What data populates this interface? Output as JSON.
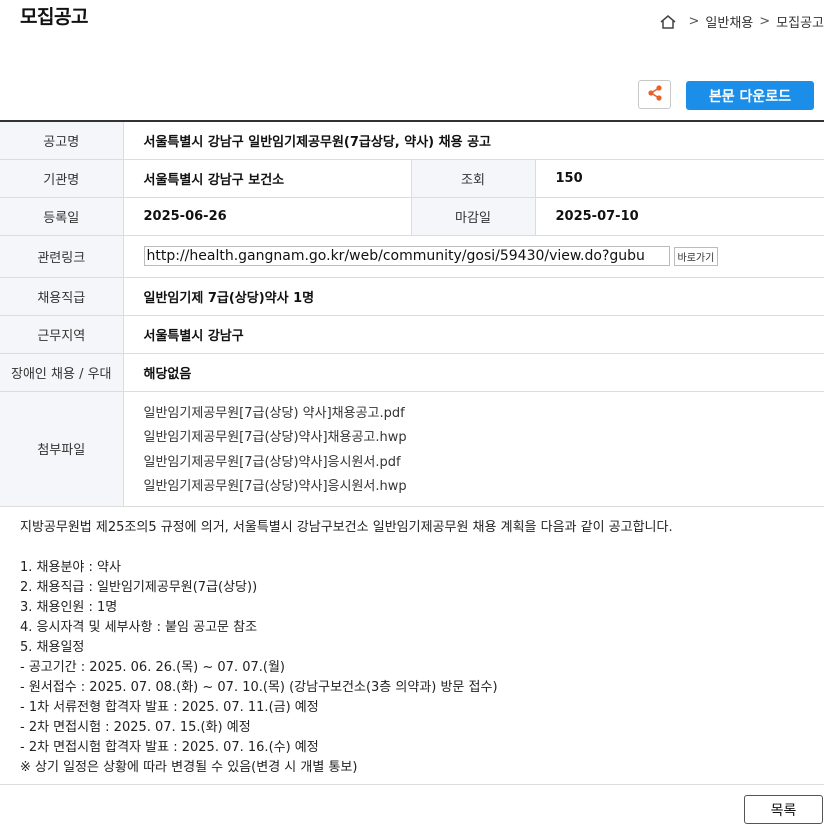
{
  "page": {
    "title": "모집공고"
  },
  "breadcrumb": {
    "items": [
      "일반채용",
      "모집공고"
    ]
  },
  "actions": {
    "download_label": "본문 다운로드"
  },
  "info": {
    "title_label": "공고명",
    "title_value": "서울특별시 강남구 일반임기제공무원(7급상당, 약사) 채용 공고",
    "agency_label": "기관명",
    "agency_value": "서울특별시 강남구 보건소",
    "views_label": "조회",
    "views_value": "150",
    "posted_label": "등록일",
    "posted_value": "2025-06-26",
    "deadline_label": "마감일",
    "deadline_value": "2025-07-10",
    "link_label": "관련링크",
    "link_value": "http://health.gangnam.go.kr/web/community/gosi/59430/view.do?gubu",
    "link_go_label": "바로가기",
    "position_label": "채용직급",
    "position_value": "일반임기제 7급(상당)약사 1명",
    "region_label": "근무지역",
    "region_value": "서울특별시 강남구",
    "disability_label": "장애인 채용 / 우대",
    "disability_value": "해당없음",
    "attachments_label": "첨부파일",
    "attachments": [
      "일반임기제공무원[7급(상당) 약사]채용공고.pdf",
      "일반임기제공무원[7급(상당)약사]채용공고.hwp",
      "일반임기제공무원[7급(상당)약사]응시원서.pdf",
      "일반임기제공무원[7급(상당)약사]응시원서.hwp"
    ]
  },
  "body": {
    "intro": "지방공무원법 제25조의5 규정에 의거, 서울특별시 강남구보건소 일반임기제공무원 채용 계획을 다음과 같이 공고합니다.",
    "lines": [
      "1. 채용분야 : 약사",
      "2. 채용직급 : 일반임기제공무원(7급(상당))",
      "3. 채용인원 : 1명",
      "4. 응시자격 및 세부사항 : 붙임 공고문 참조",
      "5. 채용일정",
      "- 공고기간 : 2025. 06. 26.(목) ~ 07. 07.(월)",
      "- 원서접수 : 2025. 07. 08.(화) ~ 07. 10.(목) (강남구보건소(3층 의약과) 방문 접수)",
      "- 1차 서류전형 합격자 발표 : 2025. 07. 11.(금) 예정",
      "- 2차 면접시험 : 2025. 07. 15.(화) 예정",
      "- 2차 면접시험 합격자 발표 : 2025. 07. 16.(수) 예정",
      "※ 상기 일정은 상황에 따라 변경될 수 있음(변경 시 개별 통보)"
    ]
  },
  "footer": {
    "list_label": "목록"
  },
  "colors": {
    "accent": "#1a8ee8",
    "share": "#e8612c",
    "header_bg": "#f4f6f9"
  }
}
